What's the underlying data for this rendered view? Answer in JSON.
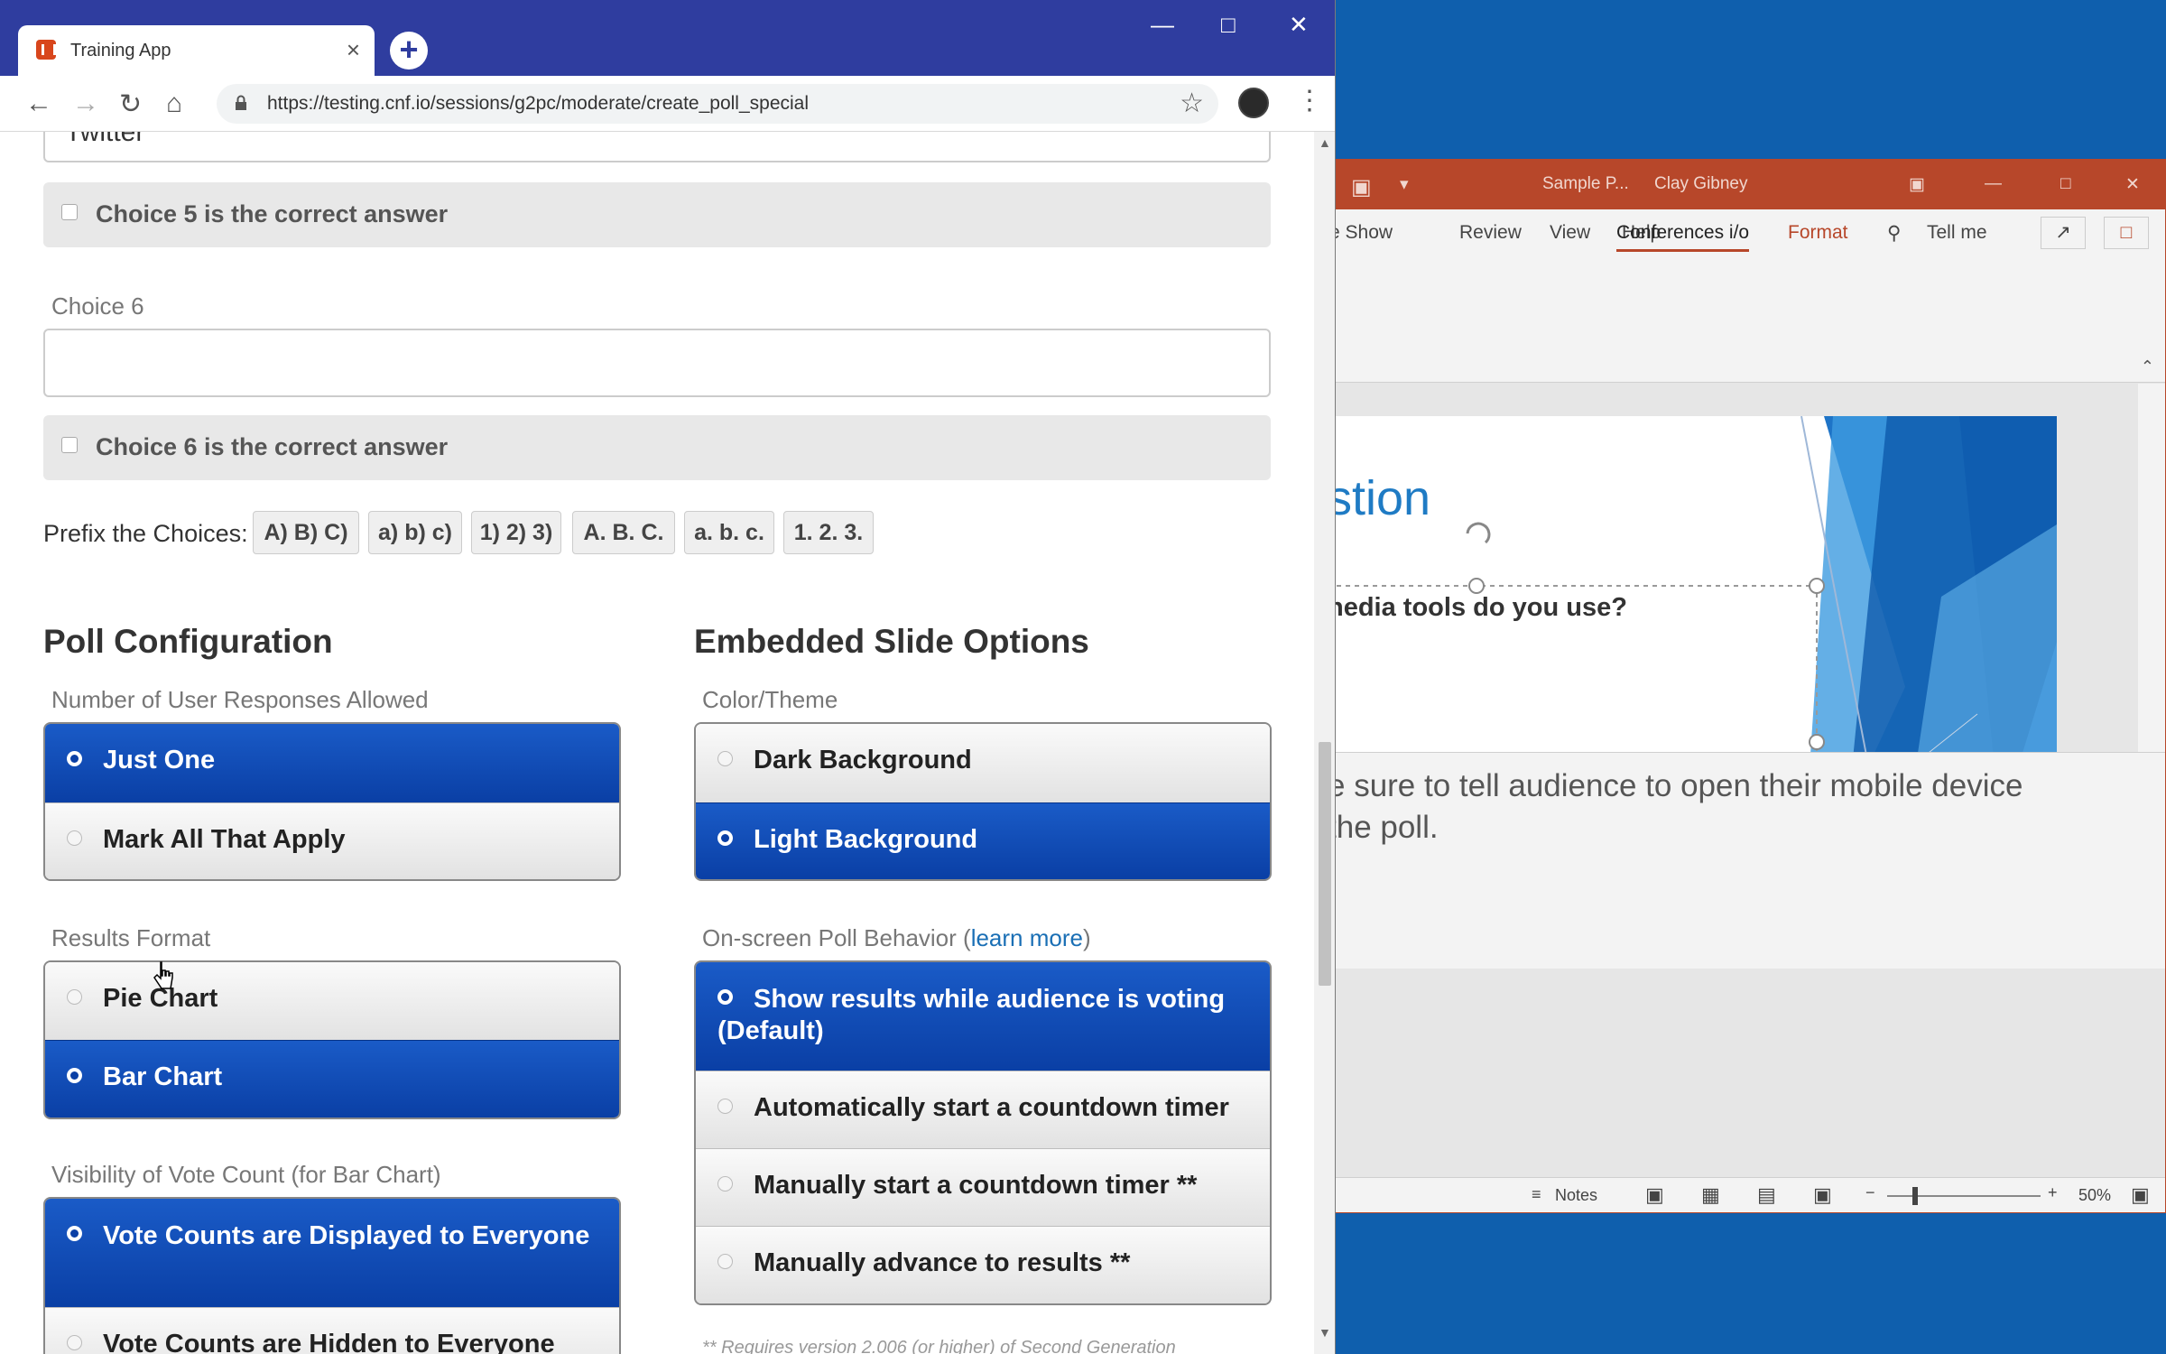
{
  "colors": {
    "browser_frame": "#2f3d9f",
    "selected_option": "#0a3fa5",
    "ppt_accent": "#b7472a",
    "desktop": "#0f5fad"
  },
  "browser": {
    "tab_title": "Training App",
    "url": "https://testing.cnf.io/sessions/g2pc/moderate/create_poll_special"
  },
  "form": {
    "partial_input_value": "Twitter",
    "choice5_correct_label": "Choice 5 is the correct answer",
    "choice6_label": "Choice 6",
    "choice6_value": "",
    "choice6_correct_label": "Choice 6 is the correct answer",
    "prefix_label": "Prefix the Choices:",
    "prefix_options": [
      "A) B) C)",
      "a) b) c)",
      "1) 2) 3)",
      "A. B. C.",
      "a. b. c.",
      "1. 2. 3."
    ]
  },
  "poll_config": {
    "heading": "Poll Configuration",
    "responses": {
      "label": "Number of User Responses Allowed",
      "options": [
        "Just One",
        "Mark All That Apply"
      ],
      "selected": "Just One"
    },
    "results_format": {
      "label": "Results Format",
      "options": [
        "Pie Chart",
        "Bar Chart"
      ],
      "selected": "Bar Chart"
    },
    "vote_visibility": {
      "label": "Visibility of Vote Count (for Bar Chart)",
      "options": [
        "Vote Counts are Displayed to Everyone",
        "Vote Counts are Hidden to Everyone"
      ],
      "selected": "Vote Counts are Displayed to Everyone"
    }
  },
  "slide_options": {
    "heading": "Embedded Slide Options",
    "theme": {
      "label": "Color/Theme",
      "options": [
        "Dark Background",
        "Light Background"
      ],
      "selected": "Light Background"
    },
    "behavior": {
      "label": "On-screen Poll Behavior (",
      "link": "learn more",
      "label_close": ")",
      "options": [
        "Show results while audience is voting (Default)",
        "Automatically start a countdown timer",
        "Manually start a countdown timer **",
        "Manually advance to results **"
      ],
      "selected": "Show results while audience is voting (Default)"
    },
    "footnote": "** Requires version 2.006 (or higher) of Second Generation"
  },
  "powerpoint": {
    "title": "Sample P...",
    "user": "Clay Gibney",
    "tabs": [
      "e Show",
      "Review",
      "View",
      "Help",
      "Conferences i/o",
      "Format",
      "Tell me"
    ],
    "active_tab": "Conferences i/o",
    "slide_title": "stion",
    "slide_text": "nedia tools do you use?",
    "notes_line1": "e sure to tell audience to open their mobile device",
    "notes_line2": "the poll.",
    "status_notes": "Notes",
    "zoom": "50%"
  }
}
